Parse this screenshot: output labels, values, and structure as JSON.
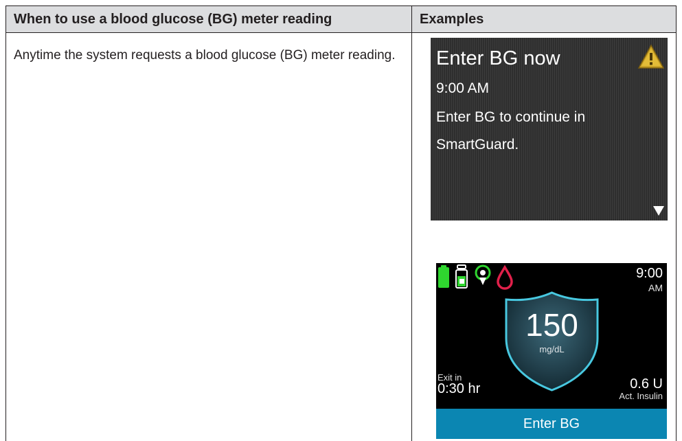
{
  "table": {
    "headers": [
      "When to use a blood glucose (BG) meter reading",
      "Examples"
    ],
    "row": {
      "description": "Anytime the system requests a blood glucose (BG) meter reading."
    }
  },
  "screen1": {
    "title": "Enter BG now",
    "time": "9:00 AM",
    "message": "Enter BG to continue in SmartGuard.",
    "icons": [
      "warning-triangle-icon",
      "scroll-down-arrow-icon"
    ],
    "colors": {
      "background": "#2e2e2e",
      "warning": "#c9a227"
    }
  },
  "screen2": {
    "time": "9:00",
    "ampm": "AM",
    "bg_value": "150",
    "bg_unit": "mg/dL",
    "exit_label": "Exit in",
    "exit_time": "0:30 hr",
    "insulin_value": "0.6 U",
    "insulin_label": "Act. Insulin",
    "button_label": "Enter BG",
    "icons": [
      "battery-icon",
      "reservoir-icon",
      "sensor-connection-icon",
      "blood-drop-icon",
      "shield-icon"
    ],
    "colors": {
      "button": "#0b86b2",
      "shield_outline": "#48c8e0",
      "status_green": "#2fd62f",
      "drop": "#e0204a"
    }
  }
}
